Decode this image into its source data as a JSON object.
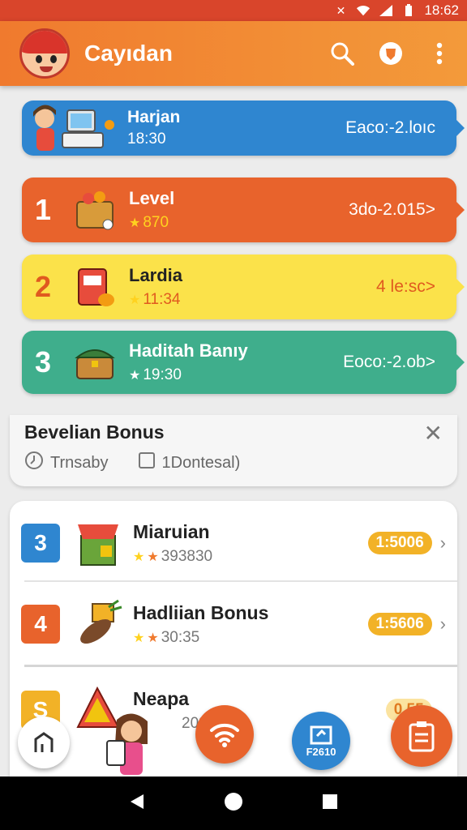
{
  "status": {
    "time": "18:62"
  },
  "app": {
    "title": "Cayıdan"
  },
  "top_card": {
    "title": "Harjan",
    "time": "18:30",
    "right": "Eaco:-2.loıc",
    "color": "#2f86d0"
  },
  "cards": [
    {
      "rank": "1",
      "title": "Level",
      "sub": "870",
      "right": "3do-2.015>",
      "color": "#e8632c",
      "text_color": "#ffffff"
    },
    {
      "rank": "2",
      "title": "Lardia",
      "sub": "11:34",
      "right": "4 le:sc>",
      "color": "#fbe24a",
      "text_color": "#e05a1f"
    },
    {
      "rank": "3",
      "title": "Haditah Banıy",
      "sub": "19:30",
      "right": "Eoco:-2.ob>",
      "color": "#3fae8c",
      "text_color": "#ffffff"
    }
  ],
  "bonus": {
    "title": "Bevelian Bonus",
    "chip1": "Trnsaby",
    "chip2": "1Dontesal)"
  },
  "list": [
    {
      "badge": "3",
      "badge_color": "#2f86d0",
      "title": "Miaruian",
      "sub": "393830",
      "pill": "1:5006"
    },
    {
      "badge": "4",
      "badge_color": "#e8632c",
      "title": "Hadliian Bonus",
      "sub": "30:35",
      "pill": "1:5606"
    },
    {
      "badge": "S",
      "badge_color": "#f2b227",
      "title": "Neapa",
      "sub": "20303",
      "pill": "0 55"
    }
  ],
  "fab": {
    "label": "F2610"
  }
}
